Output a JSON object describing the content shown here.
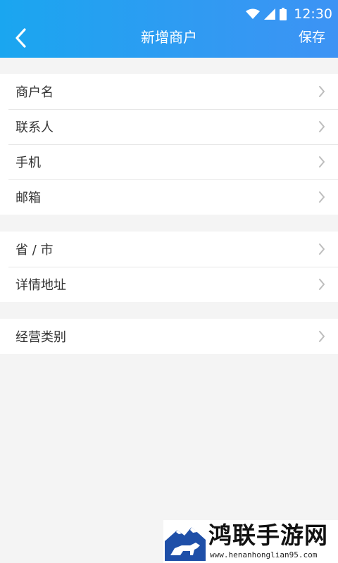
{
  "status_bar": {
    "time": "12:30",
    "icons": [
      "wifi-icon",
      "signal-icon",
      "battery-icon"
    ]
  },
  "header": {
    "title": "新增商户",
    "save_label": "保存",
    "back_icon": "chevron-left-icon"
  },
  "groups": [
    {
      "items": [
        {
          "label": "商户名"
        },
        {
          "label": "联系人"
        },
        {
          "label": "手机"
        },
        {
          "label": "邮箱"
        }
      ]
    },
    {
      "items": [
        {
          "label": "省 / 市"
        },
        {
          "label": "详情地址"
        }
      ]
    },
    {
      "items": [
        {
          "label": "经营类别"
        }
      ]
    }
  ],
  "watermark": {
    "title": "鸿联手游网",
    "url": "www.henanhonglian95.com"
  },
  "colors": {
    "header_start": "#1aa6f0",
    "header_end": "#3d93f4",
    "background": "#f4f4f4",
    "row_text": "#333333",
    "chevron": "#bdbdbd"
  }
}
